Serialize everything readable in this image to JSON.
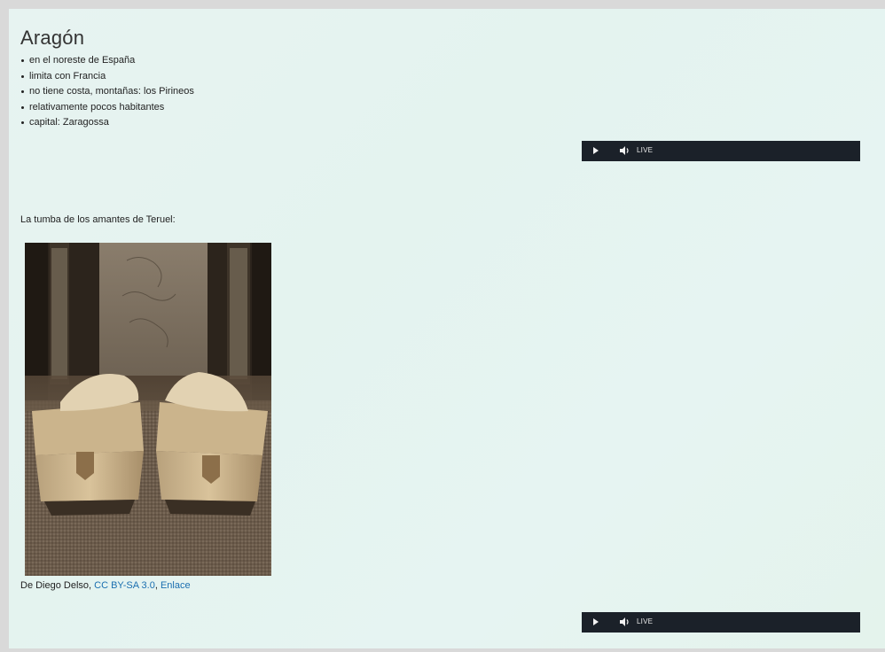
{
  "page": {
    "title": "Aragón",
    "facts": [
      "en el noreste de España",
      "limita con Francia",
      "no tiene costa, montañas: los Pirineos",
      "relativamente pocos habitantes",
      "capital: Zaragossa"
    ],
    "subtitle": "La tumba de los amantes de Teruel:",
    "caption": {
      "prefix": "De Diego Delso, ",
      "license_link": "CC BY-SA 3.0",
      "separator": ", ",
      "source_link": "Enlace"
    }
  },
  "audio_players": [
    {
      "live_label": "LIVE",
      "play_icon": "play-icon",
      "volume_icon": "volume-icon"
    },
    {
      "live_label": "LIVE",
      "play_icon": "play-icon",
      "volume_icon": "volume-icon"
    }
  ],
  "colors": {
    "background": "#e6f4f0",
    "player_bar": "#1b2129",
    "link": "#1a6fb0"
  }
}
